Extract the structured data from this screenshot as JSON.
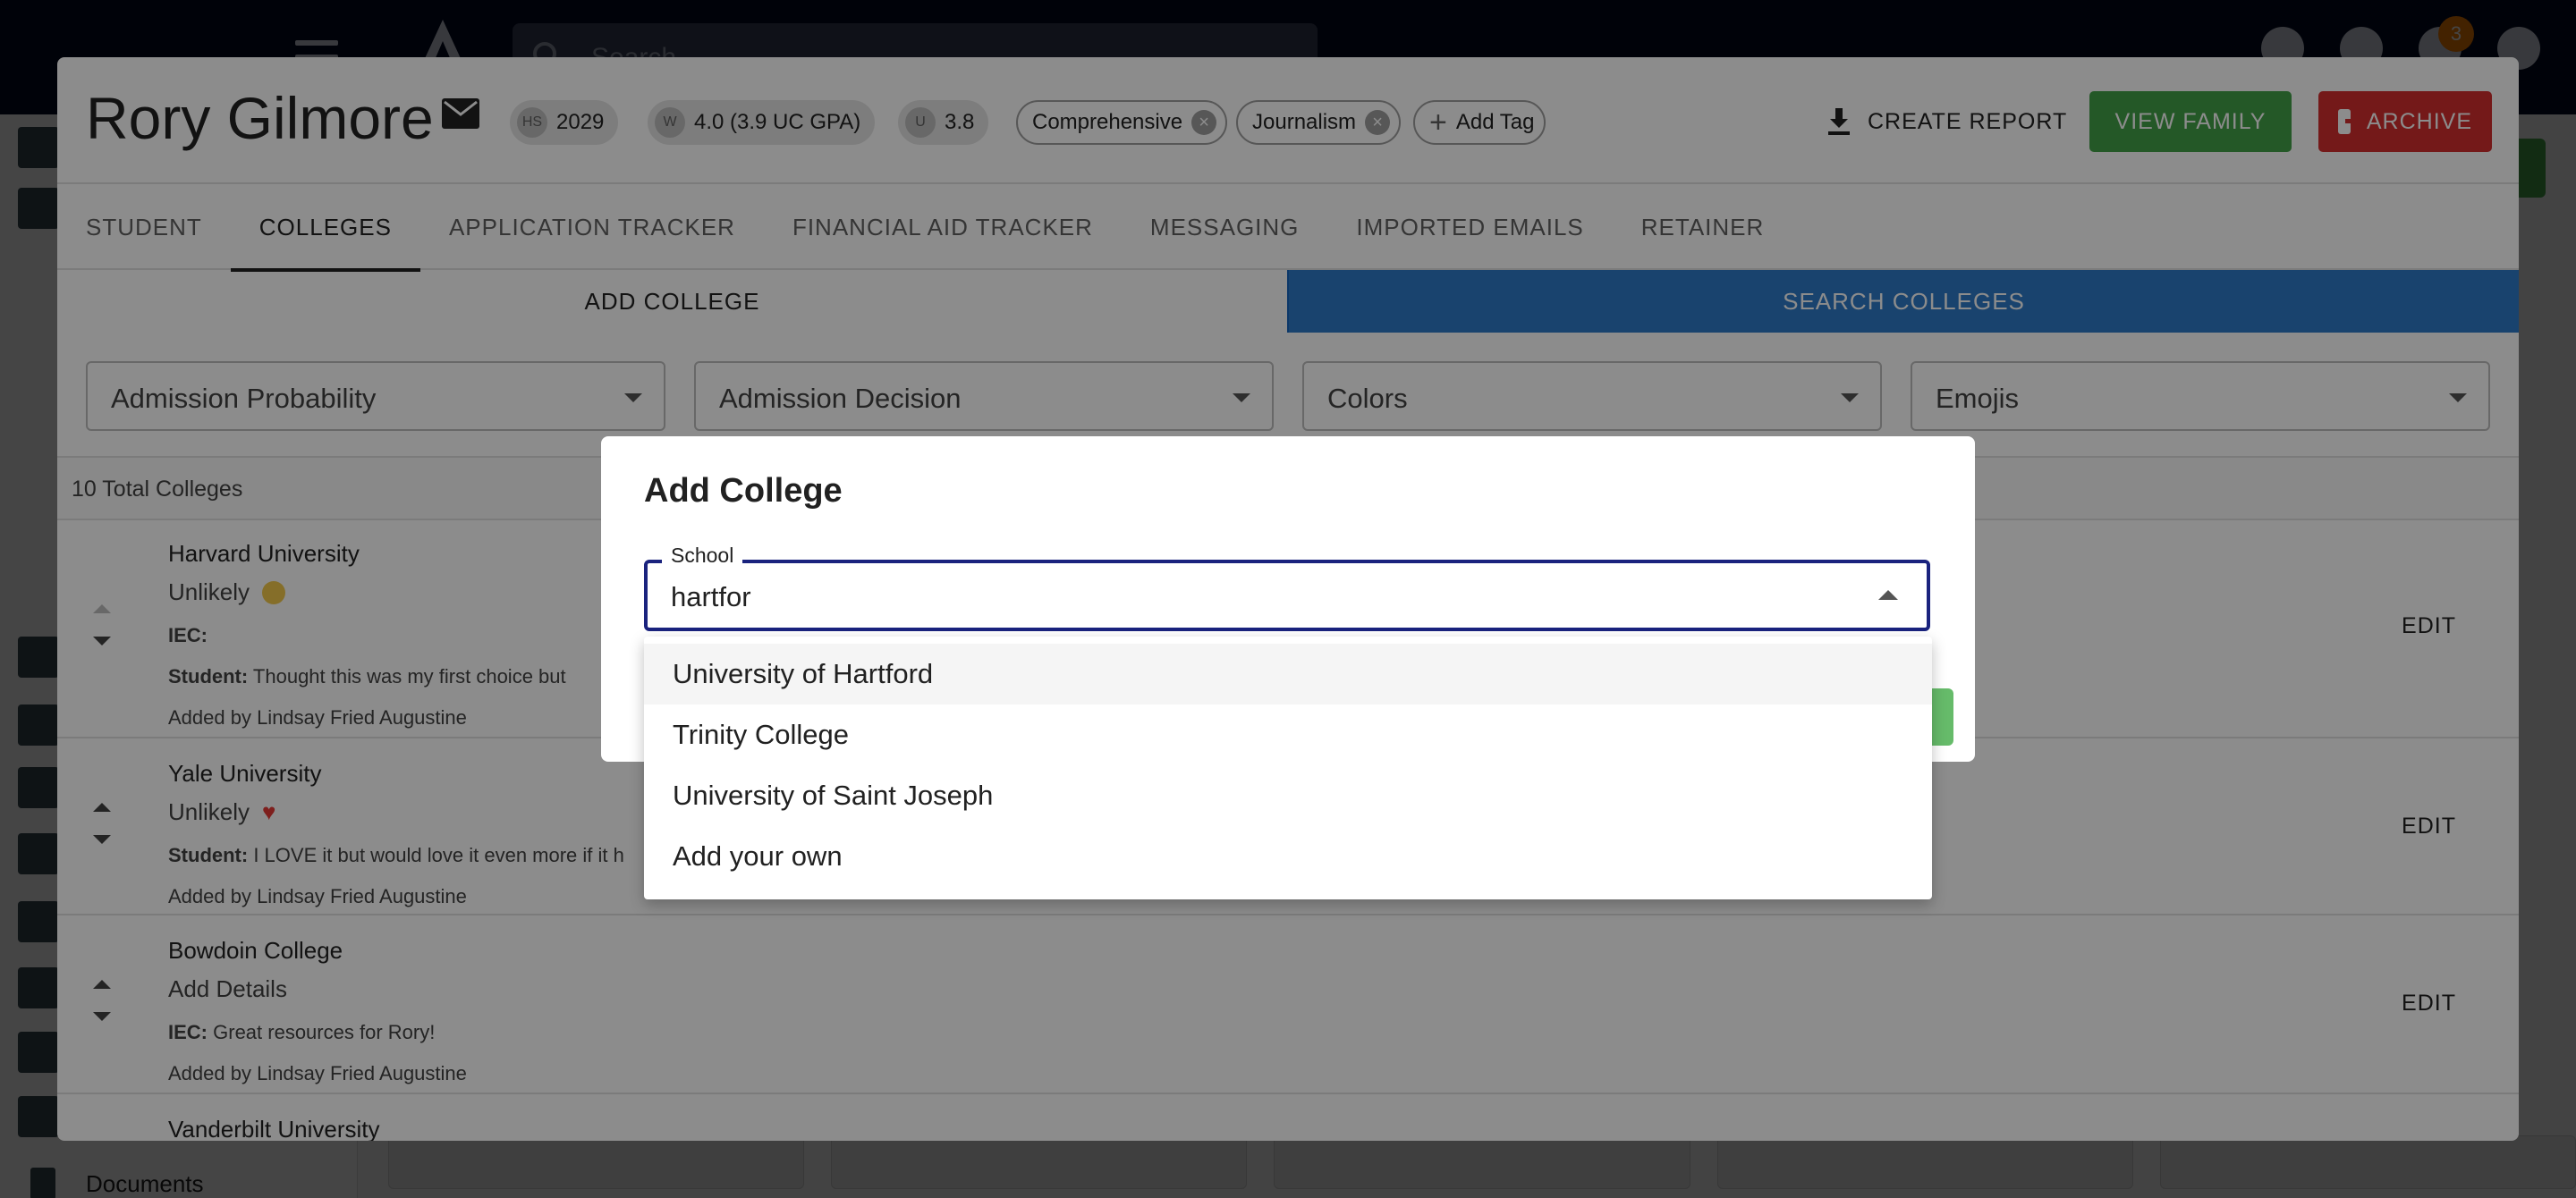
{
  "appbar": {
    "search_placeholder": "Search",
    "notification_count": "3"
  },
  "sidebar": {
    "documents_label": "Documents"
  },
  "student": {
    "name": "Rory Gilmore",
    "hs_badge": "HS",
    "hs_year": "2029",
    "w_badge": "W",
    "weighted_gpa": "4.0 (3.9 UC GPA)",
    "u_badge": "U",
    "unweighted_gpa": "3.8",
    "tags": [
      "Comprehensive",
      "Journalism"
    ],
    "add_tag_label": "Add Tag",
    "create_report_label": "CREATE REPORT",
    "view_family_label": "VIEW FAMILY",
    "archive_label": "ARCHIVE"
  },
  "tabs": [
    "STUDENT",
    "COLLEGES",
    "APPLICATION TRACKER",
    "FINANCIAL AID TRACKER",
    "MESSAGING",
    "IMPORTED EMAILS",
    "RETAINER"
  ],
  "active_tab": "COLLEGES",
  "subtabs": {
    "add": "ADD COLLEGE",
    "search": "SEARCH COLLEGES"
  },
  "filters": [
    "Admission Probability",
    "Admission Decision",
    "Colors",
    "Emojis"
  ],
  "total_label": "10 Total Colleges",
  "colleges": [
    {
      "name": "Harvard University",
      "likelihood": "Unlikely",
      "iec_label": "IEC:",
      "iec_text": "",
      "student_label": "Student:",
      "student_text": "Thought this was my first choice but",
      "added_by": "Added by Lindsay Fried Augustine",
      "edit": "EDIT"
    },
    {
      "name": "Yale University",
      "likelihood": "Unlikely",
      "student_label": "Student:",
      "student_text": "I LOVE it but would love it even more if it h",
      "added_by": "Added by Lindsay Fried Augustine",
      "edit": "EDIT"
    },
    {
      "name": "Bowdoin College",
      "likelihood": "Add Details",
      "iec_label": "IEC:",
      "iec_text": "Great resources for Rory!",
      "added_by": "Added by Lindsay Fried Augustine",
      "edit": "EDIT"
    },
    {
      "name": "Vanderbilt University"
    }
  ],
  "add_college_dialog": {
    "title": "Add College",
    "field_label": "School",
    "field_value": "hartfor",
    "options": [
      "University of Hartford",
      "Trinity College",
      "University of Saint Joseph",
      "Add your own"
    ]
  }
}
